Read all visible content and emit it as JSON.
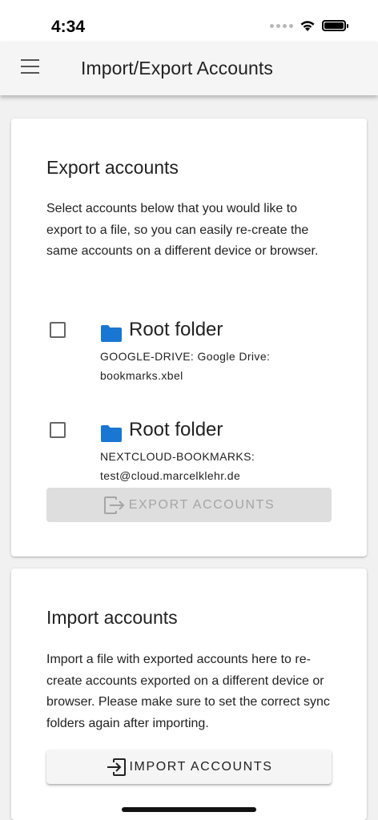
{
  "status_bar": {
    "time": "4:34",
    "icons": [
      "signal-dots-icon",
      "wifi-icon",
      "battery-icon"
    ]
  },
  "app_bar": {
    "menu_icon": "menu-icon",
    "title": "Import/Export Accounts"
  },
  "export": {
    "title": "Export accounts",
    "description": "Select accounts below that you would like to export to a file, so you can easily re-create the same accounts on a different device or browser.",
    "accounts": [
      {
        "checked": false,
        "icon": "folder-icon",
        "name": "Root folder",
        "detail": "GOOGLE-DRIVE: Google Drive: bookmarks.xbel"
      },
      {
        "checked": false,
        "icon": "folder-icon",
        "name": "Root folder",
        "detail": "NEXTCLOUD-BOOKMARKS: test@cloud.marcelklehr.de"
      }
    ],
    "button_label": "EXPORT ACCOUNTS",
    "button_icon": "export-icon"
  },
  "import": {
    "title": "Import accounts",
    "description": "Import a file with exported accounts here to re-create accounts exported on a different device or browser. Please make sure to set the correct sync folders again after importing.",
    "button_label": "IMPORT ACCOUNTS",
    "button_icon": "import-icon"
  },
  "colors": {
    "folder": "#1976d2",
    "app_bar_bg": "#f5f5f5",
    "disabled_button_bg": "#dedede",
    "disabled_button_text": "#a5a5a5"
  }
}
